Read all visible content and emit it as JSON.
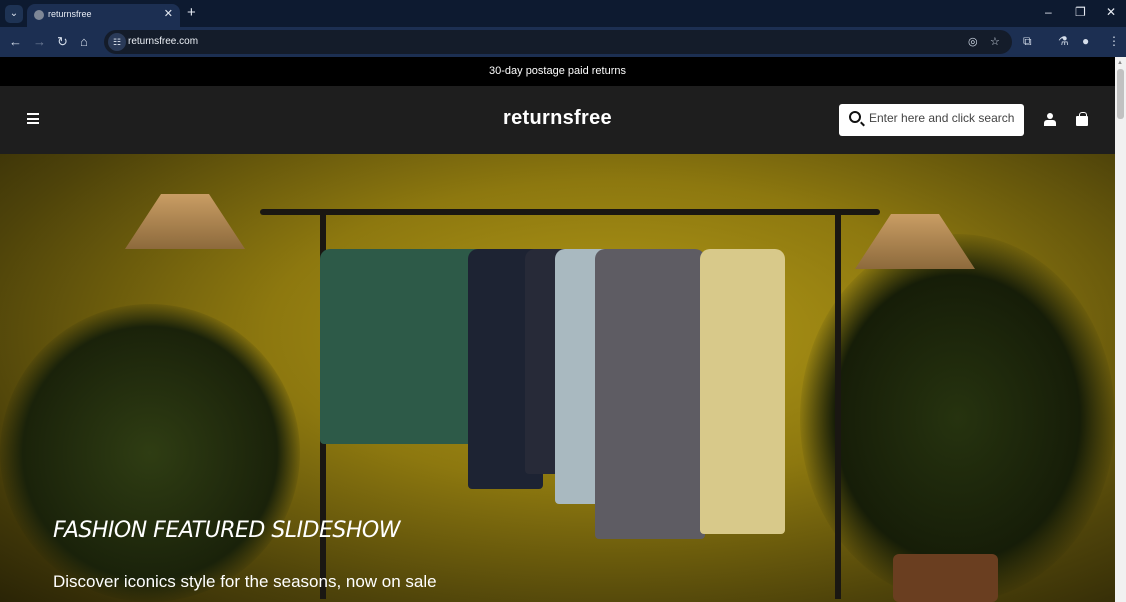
{
  "browser": {
    "tab_title": "returnsfree",
    "url": "returnsfree.com"
  },
  "site": {
    "announcement": "30-day postage paid returns",
    "logo": "returnsfree",
    "search_placeholder": "Enter here and click search"
  },
  "hero": {
    "title": "FASHION FEATURED SLIDESHOW",
    "subtitle": "Discover iconics style for the seasons, now on sale"
  }
}
